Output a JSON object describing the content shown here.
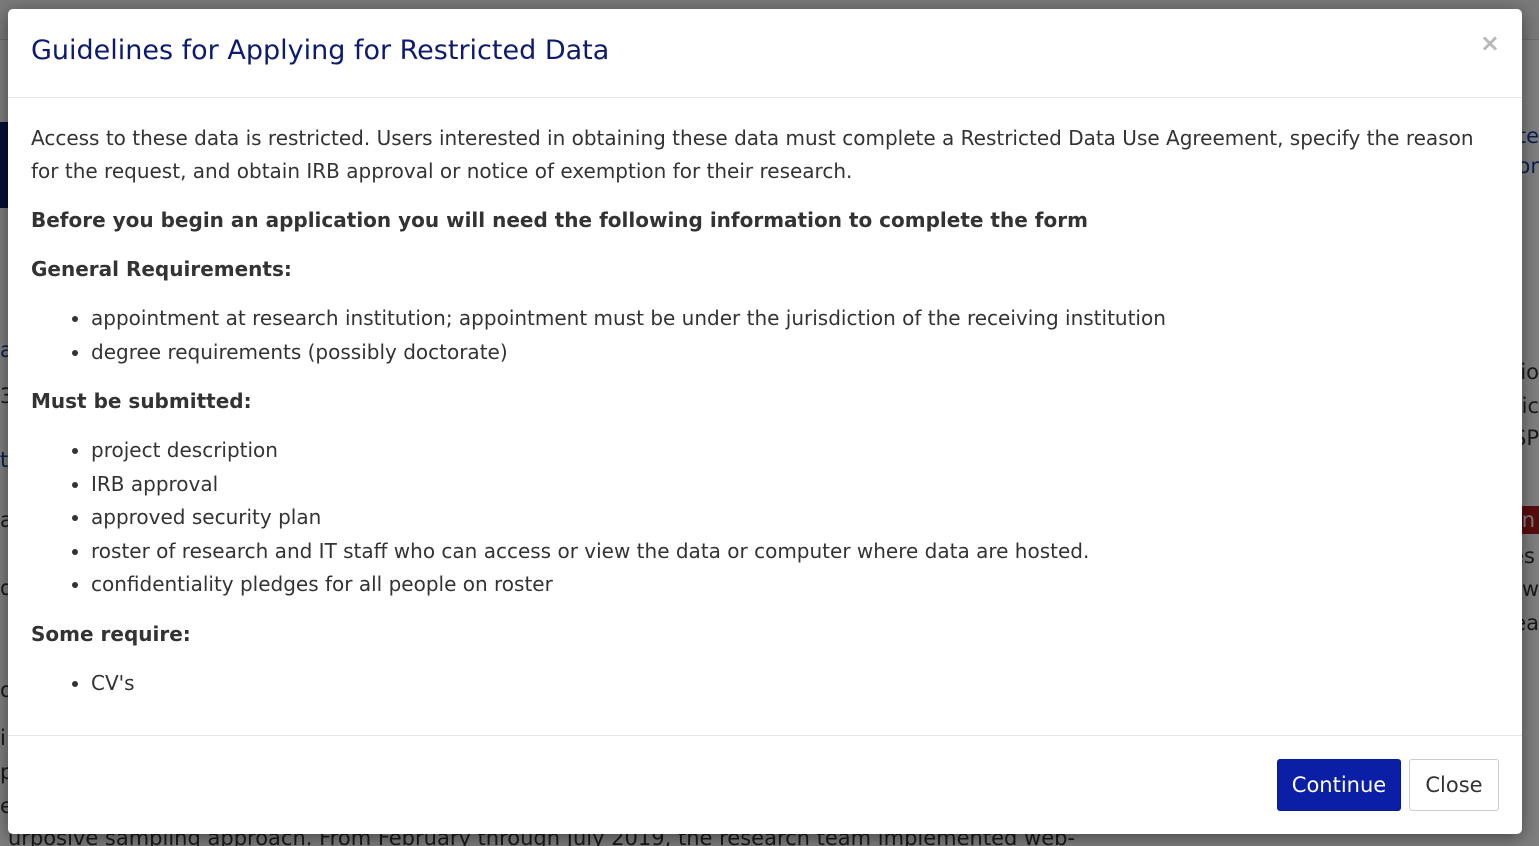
{
  "background": {
    "right_fragments": [
      "ate",
      "or",
      "io",
      "lic",
      "SP",
      "n",
      "es",
      "w",
      "ea"
    ],
    "left_fragments": [
      "a",
      "t",
      "3",
      "a",
      "d",
      "o",
      "i",
      "p",
      "e",
      "a"
    ],
    "bottom_line": "urposive sampling approach. From February through July 2019, the research team implemented web-"
  },
  "modal": {
    "title": "Guidelines for Applying for Restricted Data",
    "close_symbol": "×",
    "intro": "Access to these data is restricted. Users interested in obtaining these data must complete a Restricted Data Use Agreement, specify the reason for the request, and obtain IRB approval or notice of exemption for their research.",
    "lead": "Before you begin an application you will need the following information to complete the form",
    "sections": [
      {
        "heading": "General Requirements:",
        "items": [
          "appointment at research institution; appointment must be under the jurisdiction of the receiving institution",
          "degree requirements (possibly doctorate)"
        ]
      },
      {
        "heading": "Must be submitted:",
        "items": [
          "project description",
          "IRB approval",
          "approved security plan",
          "roster of research and IT staff who can access or view the data or computer where data are hosted.",
          "confidentiality pledges for all people on roster"
        ]
      },
      {
        "heading": "Some require:",
        "items": [
          "CV's"
        ]
      }
    ],
    "buttons": {
      "continue": "Continue",
      "close": "Close"
    }
  },
  "colors": {
    "title": "#0d1b6e",
    "primary_button": "#0a1ea6",
    "overlay": "#7a7a7a"
  }
}
